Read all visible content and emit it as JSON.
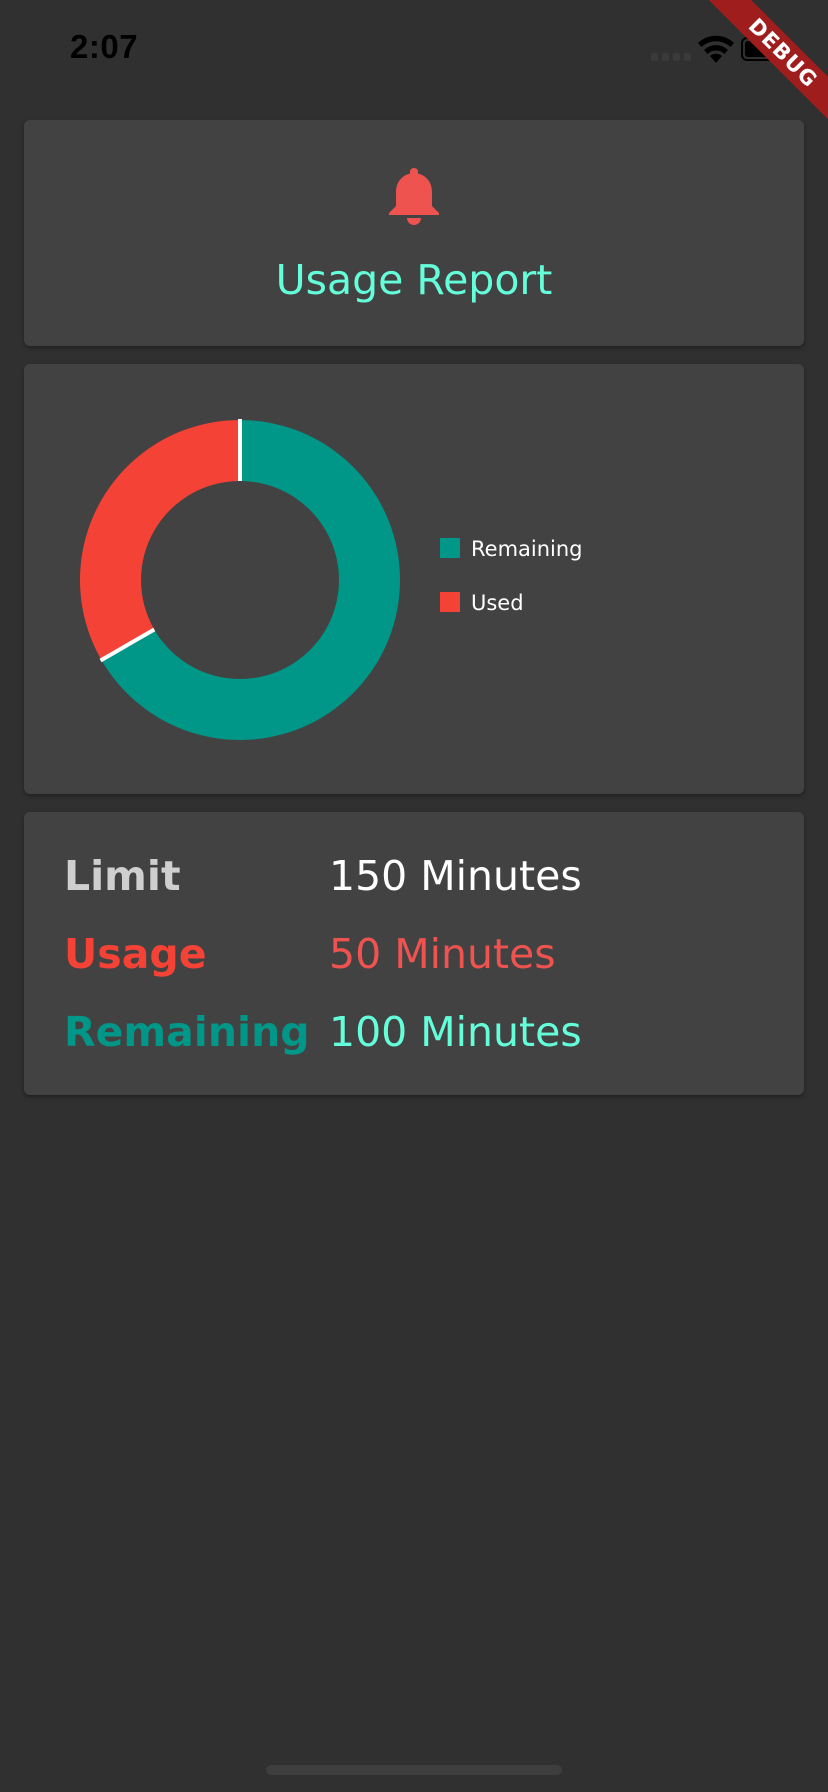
{
  "status_bar": {
    "time": "2:07",
    "debug_label": "DEBUG"
  },
  "header": {
    "icon": "bell-icon",
    "title": "Usage Report"
  },
  "chart_data": {
    "type": "pie",
    "style": "donut",
    "categories": [
      "Remaining",
      "Used"
    ],
    "values": [
      100,
      50
    ],
    "colors": [
      "#009688",
      "#f44336"
    ],
    "legend_position": "right"
  },
  "legend": {
    "items": [
      {
        "label": "Remaining",
        "color": "#009688"
      },
      {
        "label": "Used",
        "color": "#f44336"
      }
    ]
  },
  "stats": {
    "rows": [
      {
        "label": "Limit",
        "value": "150 Minutes",
        "label_color": "#cfcfcf",
        "value_color": "#ffffff"
      },
      {
        "label": "Usage",
        "value": "50 Minutes",
        "label_color": "#f44336",
        "value_color": "#ef5350"
      },
      {
        "label": "Remaining",
        "value": "100 Minutes",
        "label_color": "#009688",
        "value_color": "#64ffda"
      }
    ]
  },
  "colors": {
    "background": "#303030",
    "card": "#424242",
    "accent": "#64ffda",
    "bell": "#ef5350"
  }
}
